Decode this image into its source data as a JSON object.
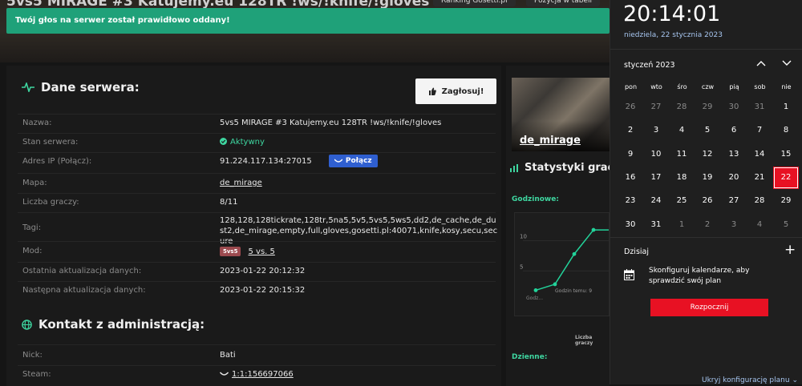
{
  "background": {
    "page_title": "5vs5 MIRAGE #3 Katujemy.eu 128TR !ws/!knife/!gloves",
    "tab1": "Ranking Gosetti.pl",
    "tab2": "Pozycja w tabeli"
  },
  "toast": {
    "text": "Twój głos na serwer został prawidłowo oddany!",
    "color": "#1fa179"
  },
  "server": {
    "title": "Dane serwera:",
    "vote_label": "Zagłosuj!",
    "rows": {
      "name_label": "Nazwa:",
      "name": "5vs5 MIRAGE #3 Katujemy.eu 128TR !ws/!knife/!gloves",
      "status_label": "Stan serwera:",
      "status": "Aktywny",
      "ip_label": "Adres IP (Połącz):",
      "ip": "91.224.117.134:27015",
      "connect_label": "Połącz",
      "map_label": "Mapa:",
      "map": "de_mirage",
      "players_label": "Liczba graczy:",
      "players": "8/11",
      "tags_label": "Tagi:",
      "tags": "128,128,128tickrate,128tr,5na5,5v5,5vs5,5ws5,dd2,de_cache,de_dust2,de_mirage,empty,full,gloves,gosetti.pl:40071,knife,kosy,secu,secure",
      "mod_label": "Mod:",
      "mod_badge": "5vs5",
      "mod": "5 vs. 5",
      "last_update_label": "Ostatnia aktualizacja danych:",
      "last_update": "2023-01-22 20:12:32",
      "next_update_label": "Następna aktualizacja danych:",
      "next_update": "2023-01-22 20:15:32"
    }
  },
  "contact": {
    "title": "Kontakt z administracją:",
    "nick_label": "Nick:",
    "nick": "Bati",
    "steam_label": "Steam:",
    "steam": "1:1:156697066"
  },
  "side": {
    "map_name": "de_mirage",
    "stats_title": "Statystyki graczy",
    "hourly_label": "Godzinowe:",
    "daily_label": "Dzienne:",
    "chart_caption": "Liczba graczy",
    "chart_data": {
      "type": "line",
      "ylim": [
        0,
        13
      ],
      "y_ticks": [
        5,
        10
      ],
      "x": [
        0,
        1,
        2,
        3,
        4
      ],
      "values": [
        1,
        2,
        7,
        11,
        11
      ],
      "x_first_label": "Godz...",
      "tooltip": "Godzin temu: 9",
      "line_color": "#22d39a"
    }
  },
  "calendar": {
    "time": "20:14:01",
    "date": "niedziela, 22 stycznia 2023",
    "month": "styczeń 2023",
    "weekdays": [
      "pon",
      "wto",
      "śro",
      "czw",
      "pią",
      "sob",
      "nie"
    ],
    "days": [
      [
        26,
        27,
        28,
        29,
        30,
        31,
        1
      ],
      [
        2,
        3,
        4,
        5,
        6,
        7,
        8
      ],
      [
        9,
        10,
        11,
        12,
        13,
        14,
        15
      ],
      [
        16,
        17,
        18,
        19,
        20,
        21,
        22
      ],
      [
        23,
        24,
        25,
        26,
        27,
        28,
        29
      ],
      [
        30,
        31,
        1,
        2,
        3,
        4,
        5
      ]
    ],
    "today": 22,
    "today_label": "Dzisiaj",
    "message": "Skonfiguruj kalendarze, aby sprawdzić swój plan",
    "start_label": "Rozpocznij",
    "hide_label": "Ukryj konfigurację planu",
    "accent": "#e81123"
  }
}
